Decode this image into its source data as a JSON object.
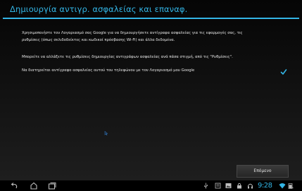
{
  "header": {
    "title": "Δημιουργία αντιγρ. ασφαλείας και επαναφ."
  },
  "content": {
    "paragraph1": [
      "Χρησιμοποιήστε τον Λογαριασμό σας Google για να δημιουργήσετε αντίγραφα ασφαλείας για τις εφαρμογές σας, τις",
      "ρυθμίσεις (όπως σελιδοδείκτες και κωδικοί πρόσβασης Wi-Fi) και άλλα δεδομένα."
    ],
    "paragraph2": "Μπορείτε να αλλάξετε τις ρυθμίσεις δημιουργίας αντιγράφων ασφαλείας ανά πάσα στιγμή, από τις \"Ρυθμίσεις\".",
    "checkbox": {
      "label": "Να διατηρείται αντίγραφο ασφαλείας αυτού του τηλεφώνου με τον Λογαριασμό μου Google",
      "checked": true
    }
  },
  "footer": {
    "next_label": "Επόμενο"
  },
  "system_bar": {
    "time": "9:28",
    "nav_icons": [
      "back-icon",
      "home-icon",
      "recent-apps-icon"
    ],
    "status_icons": [
      "usb-icon",
      "screenshot-icon",
      "gallery-icon",
      "lock-icon",
      "headset-icon",
      "wifi-icon",
      "battery-icon"
    ]
  },
  "colors": {
    "accent": "#33b5e5",
    "background": "#0b0b0b",
    "text": "#e8e8e8"
  }
}
